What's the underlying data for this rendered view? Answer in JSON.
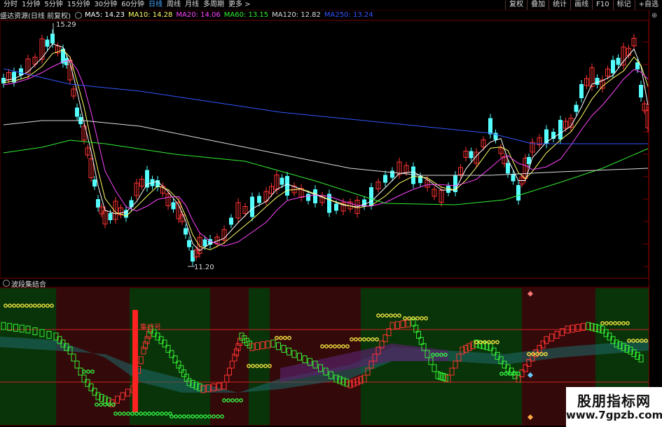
{
  "toolbar": {
    "periods": [
      "分时",
      "1分钟",
      "5分钟",
      "15分钟",
      "30分钟",
      "60分钟",
      "日线",
      "周线",
      "月线",
      "多周期",
      "更多 >"
    ],
    "active_period": "日线",
    "right_buttons": [
      "复权",
      "叠加",
      "统计",
      "画线",
      "F10",
      "标记",
      "+自选"
    ]
  },
  "main_chart": {
    "title": "盛达资源(日线 前复权)",
    "ma": [
      {
        "label": "MA5: 14.23",
        "color": "#ffffff"
      },
      {
        "label": "MA10: 14.28",
        "color": "#ffff66"
      },
      {
        "label": "MA20: 14.06",
        "color": "#ff44ff"
      },
      {
        "label": "MA60: 13.15",
        "color": "#33ee33"
      },
      {
        "label": "MA120: 12.82",
        "color": "#dddddd"
      },
      {
        "label": "MA250: 13.24",
        "color": "#3355ff"
      }
    ],
    "high_label": "15.29",
    "low_label": "11.20"
  },
  "sub_chart": {
    "title": "波段集结合",
    "signal_label": "集结号"
  },
  "colors": {
    "up": "#ff3333",
    "down": "#55ffff",
    "bg": "#000000",
    "border": "#880000"
  },
  "watermark": {
    "line1": "股朋指标网",
    "line2": "www.7gpzb.com"
  }
}
